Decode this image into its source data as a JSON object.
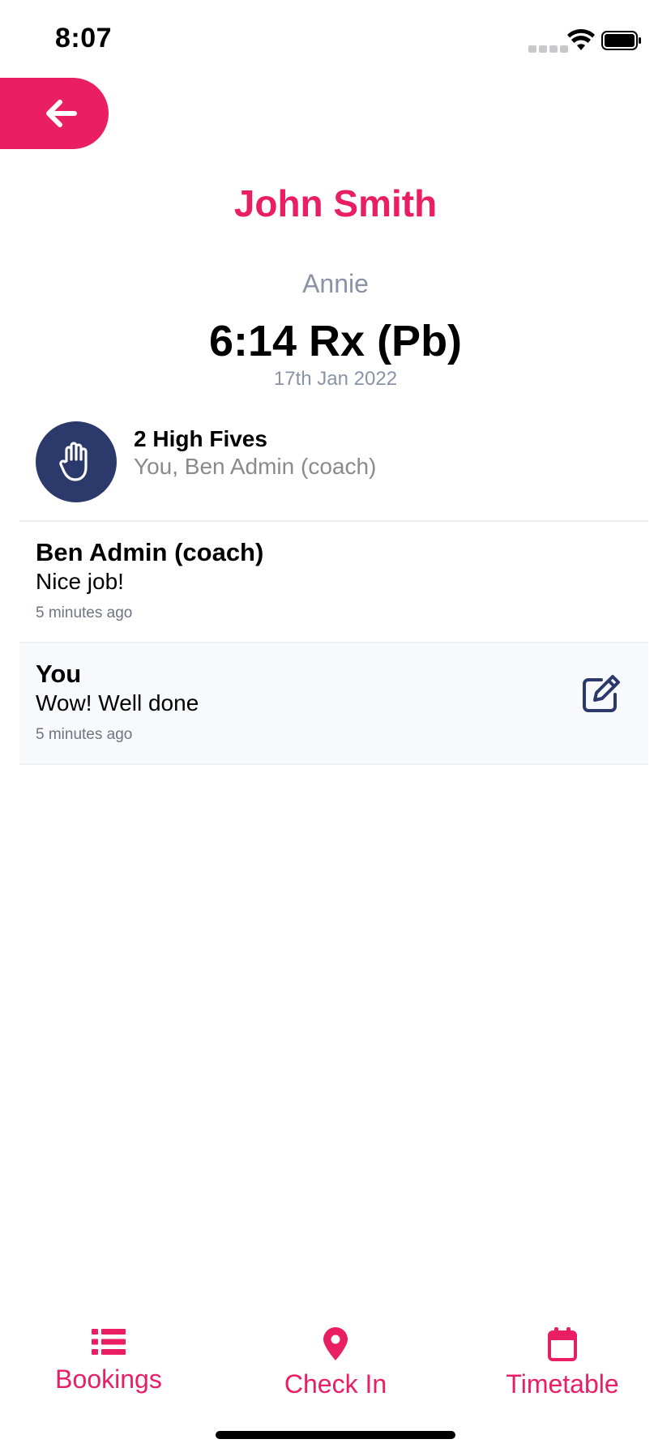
{
  "status_bar": {
    "time": "8:07"
  },
  "header": {
    "back_icon": "arrow-left-icon",
    "accent": "#e91e63"
  },
  "result": {
    "athlete": "John Smith",
    "workout": "Annie",
    "score": "6:14 Rx (Pb)",
    "date": "17th Jan 2022"
  },
  "high_fives": {
    "icon": "hand-icon",
    "title": "2 High Fives",
    "names": "You, Ben Admin (coach)",
    "circle_color": "#2b3a6b"
  },
  "comments": [
    {
      "author": "Ben Admin (coach)",
      "text": "Nice job!",
      "time": "5 minutes ago"
    },
    {
      "author": "You",
      "text": "Wow! Well done",
      "time": "5 minutes ago",
      "action_icon": "edit-icon"
    }
  ],
  "tab_bar": {
    "tabs": [
      {
        "label": "Bookings",
        "icon": "list-icon"
      },
      {
        "label": "Check In",
        "icon": "map-pin-icon"
      },
      {
        "label": "Timetable",
        "icon": "calendar-icon"
      }
    ]
  }
}
